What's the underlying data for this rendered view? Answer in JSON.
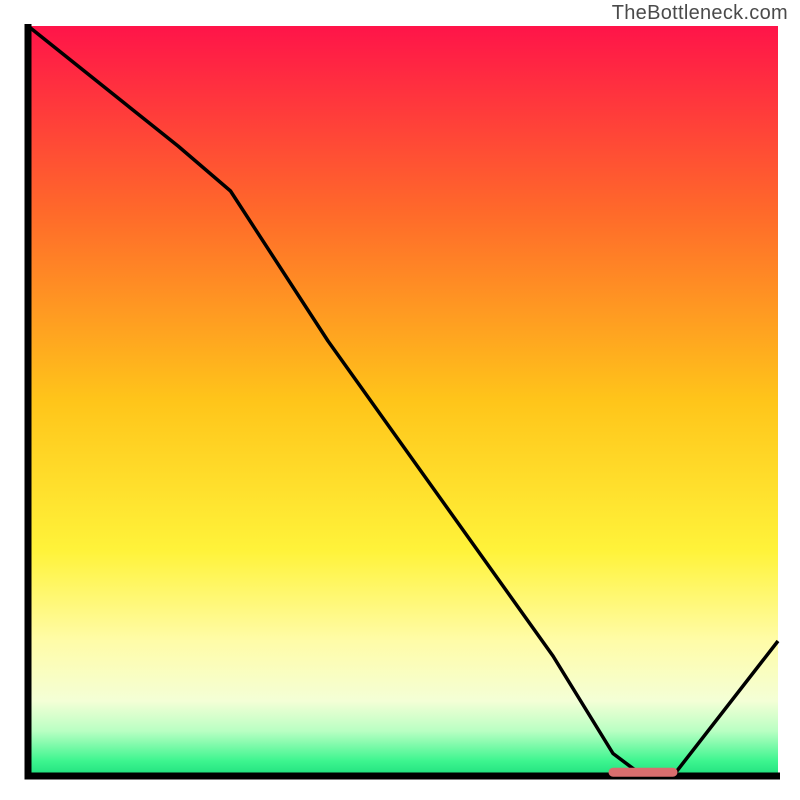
{
  "watermark": "TheBottleneck.com",
  "chart_data": {
    "type": "line",
    "title": "",
    "xlabel": "",
    "ylabel": "",
    "xlim": [
      0,
      100
    ],
    "ylim": [
      0,
      100
    ],
    "series": [
      {
        "name": "curve",
        "x": [
          0,
          10,
          20,
          27,
          40,
          55,
          70,
          78,
          82,
          86,
          100
        ],
        "y": [
          100,
          92,
          84,
          78,
          58,
          37,
          16,
          3,
          0,
          0,
          18
        ]
      }
    ],
    "marker_segment": {
      "x_start": 78,
      "x_end": 86,
      "y": 0.5
    },
    "gradient_stops": [
      {
        "offset": 0.0,
        "color": "#ff1449"
      },
      {
        "offset": 0.25,
        "color": "#ff6a2a"
      },
      {
        "offset": 0.5,
        "color": "#ffc51a"
      },
      {
        "offset": 0.7,
        "color": "#fff33a"
      },
      {
        "offset": 0.82,
        "color": "#fffca8"
      },
      {
        "offset": 0.9,
        "color": "#f4ffd6"
      },
      {
        "offset": 0.94,
        "color": "#b9ffc3"
      },
      {
        "offset": 0.98,
        "color": "#3df58f"
      },
      {
        "offset": 1.0,
        "color": "#1ee07e"
      }
    ],
    "marker_color": "#d96e6e",
    "curve_color": "#000000",
    "axis_color": "#000000"
  }
}
